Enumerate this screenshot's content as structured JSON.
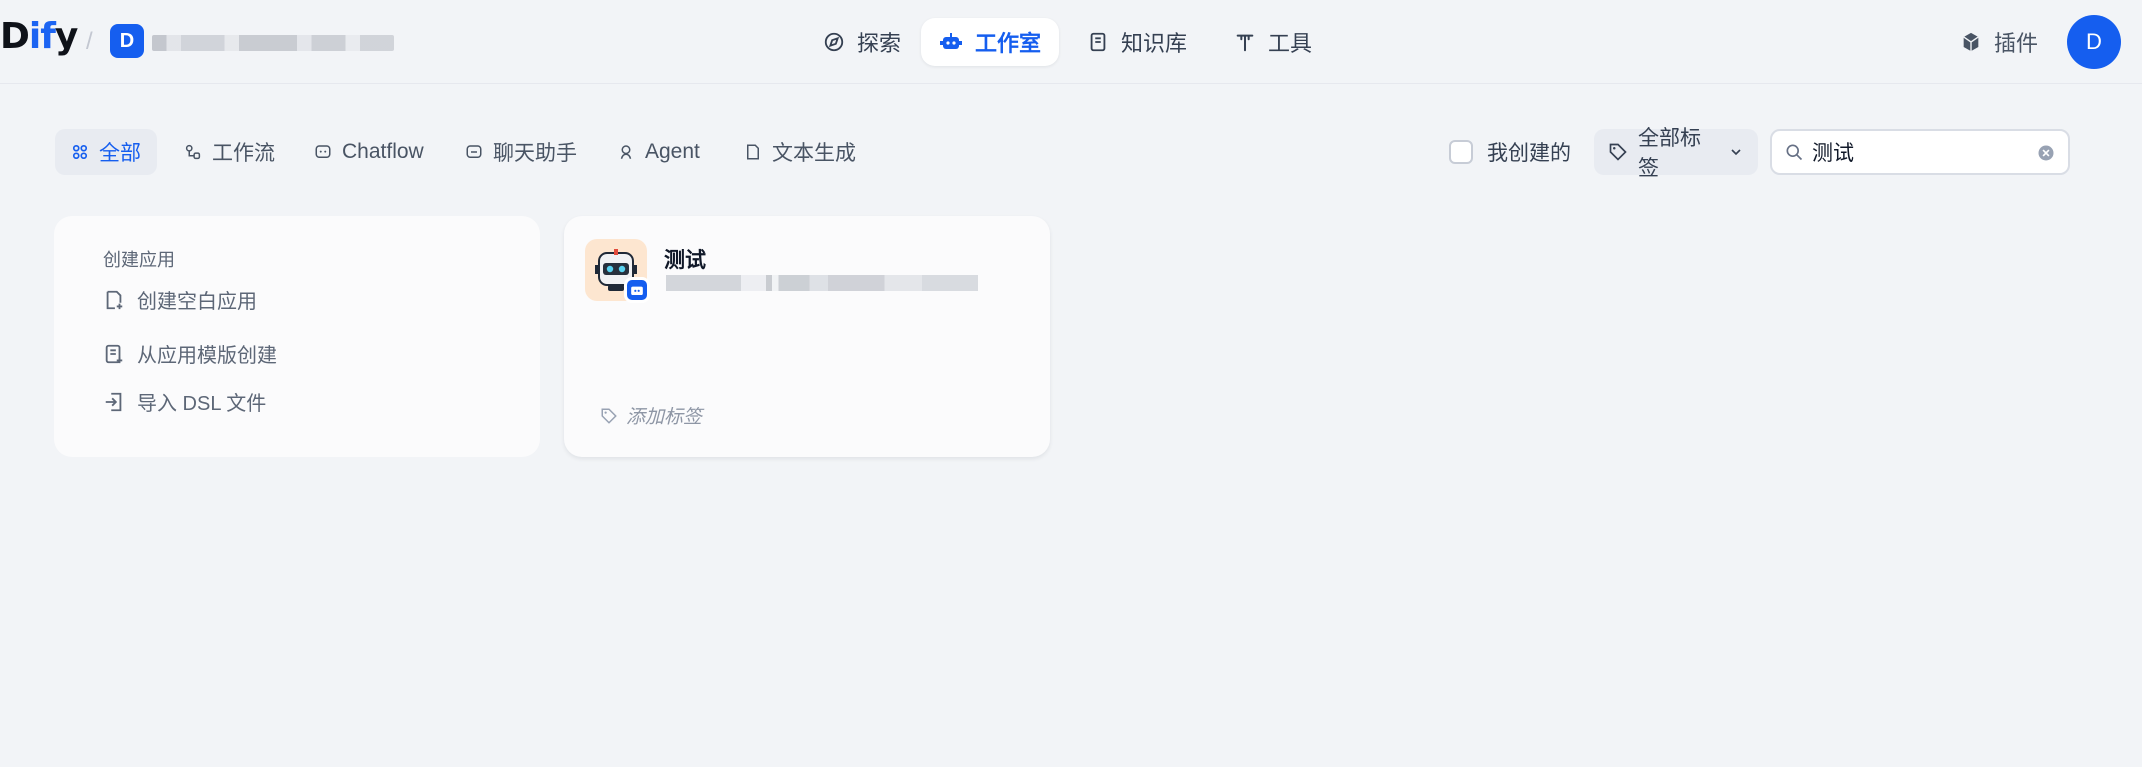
{
  "header": {
    "logo_prefix": "D",
    "logo_highlight": "if",
    "logo_suffix": "y",
    "workspace_initial": "D",
    "nav": [
      {
        "label": "探索",
        "icon": "compass-icon"
      },
      {
        "label": "工作室",
        "icon": "robot-icon",
        "active": true
      },
      {
        "label": "知识库",
        "icon": "book-icon"
      },
      {
        "label": "工具",
        "icon": "hammer-icon"
      }
    ],
    "plugins_label": "插件",
    "avatar_initial": "D"
  },
  "filters": {
    "tabs": [
      {
        "label": "全部",
        "icon": "grid-icon",
        "active": true
      },
      {
        "label": "工作流",
        "icon": "workflow-icon"
      },
      {
        "label": "Chatflow",
        "icon": "chatflow-icon"
      },
      {
        "label": "聊天助手",
        "icon": "chat-assistant-icon"
      },
      {
        "label": "Agent",
        "icon": "agent-icon"
      },
      {
        "label": "文本生成",
        "icon": "text-generation-icon"
      }
    ],
    "created_by_me_label": "我创建的",
    "tag_select_label": "全部标签",
    "search_value": "测试"
  },
  "create_panel": {
    "title": "创建应用",
    "items": [
      {
        "label": "创建空白应用",
        "icon": "blank-app-icon"
      },
      {
        "label": "从应用模版创建",
        "icon": "template-icon"
      },
      {
        "label": "导入 DSL 文件",
        "icon": "import-icon"
      }
    ]
  },
  "apps": [
    {
      "name": "测试",
      "add_tag_label": "添加标签",
      "icon": "robot-avatar-icon",
      "type_icon": "agent-type-icon"
    }
  ],
  "colors": {
    "accent": "#155eef",
    "background": "#f2f4f7",
    "card": "#fbfbfc"
  }
}
